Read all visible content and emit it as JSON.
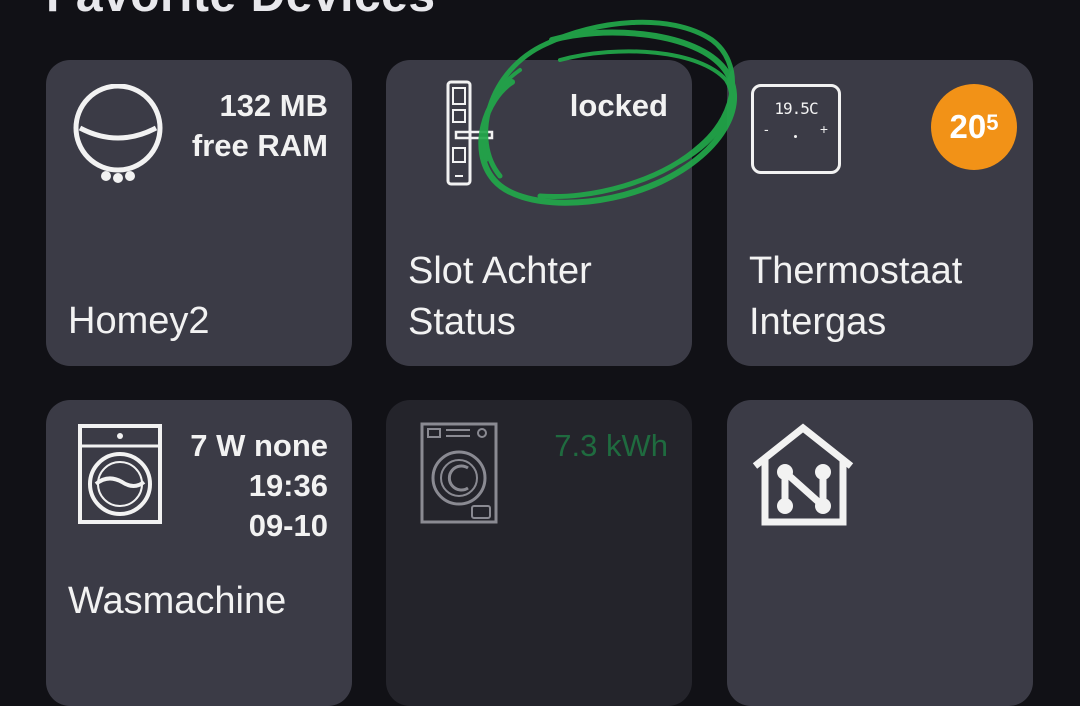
{
  "section": {
    "title": "Favorite Devices"
  },
  "cards": [
    {
      "name": "Homey2",
      "info": "132 MB\nfree RAM",
      "icon": "homey-sphere-icon",
      "inactive": false
    },
    {
      "name": "Slot Achter\nStatus",
      "info": "locked",
      "icon": "door-lock-icon",
      "inactive": false
    },
    {
      "name": "Thermostaat\nIntergas",
      "info": "",
      "icon": "thermostat-icon",
      "display": "19.5C",
      "badge": {
        "main": "20",
        "sup": "5"
      },
      "inactive": false
    },
    {
      "name": "Wasmachine",
      "info": "7 W none\n19:36\n09-10",
      "icon": "washing-machine-icon",
      "inactive": false
    },
    {
      "name": "",
      "info": "7.3 kWh",
      "icon": "washing-machine-icon",
      "inactive": true
    },
    {
      "name": "",
      "info": "",
      "icon": "homey-home-icon",
      "inactive": false
    }
  ],
  "colors": {
    "background": "#111116",
    "card": "#3b3b46",
    "card_inactive": "#24242b",
    "badge": "#f29217",
    "energy_text": "#1f6b3f",
    "annotation": "#22a84a"
  }
}
